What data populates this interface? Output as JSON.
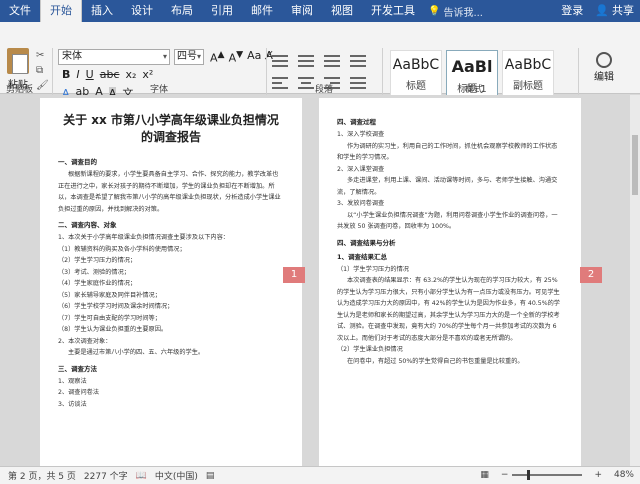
{
  "tabs": [
    "文件",
    "开始",
    "插入",
    "设计",
    "布局",
    "引用",
    "邮件",
    "审阅",
    "视图",
    "开发工具"
  ],
  "search_placeholder": "告诉我...",
  "login": "登录",
  "share": "共享",
  "ribbon": {
    "paste": "粘贴",
    "font_name": "宋体",
    "font_size": "四号",
    "format_buttons": [
      "B",
      "I",
      "U",
      "abc",
      "x₂",
      "x²"
    ],
    "styles": [
      {
        "sample": "AaBbC",
        "name": "标题"
      },
      {
        "sample": "AaBl",
        "name": "标题 1"
      },
      {
        "sample": "AaBbC",
        "name": "副标题"
      }
    ],
    "edit": "编辑",
    "groups": [
      "剪贴板",
      "字体",
      "段落",
      "样式"
    ]
  },
  "page1": {
    "title": "关于 xx 市第八小学高年级课业负担情况的调查报告",
    "s1": "一、调查目的",
    "s1_text": "根据新课程的要求，小学生要具备自主学习、合作、探究的能力，教学改革也正在进行之中，家长对孩子的期待不断增加，学生的课业负担却在不断增加。所以，本调查是希望了解我市第八小学的高年级课业负担现状，分析造成小学生课业负担过重的原因，并找到解决的对策。",
    "s2": "二、调查内容、对象",
    "s2_text": "1、本次关于小学高年级课业负担情况调查主要涉及以下内容：",
    "items": [
      "（1）教辅资料的购买及各小学科的使用情况；",
      "（2）学生学习压力的情况；",
      "（3）考试、测验的情况；",
      "（4）学生家庭作业的情况；",
      "（5）家长辅导家庭及同伴目补情况；",
      "（6）学生学校学习时间及课余时间情况；",
      "（7）学生可自由支配的学习时间等；",
      "（8）学生认为课业负担重的主要原因。"
    ],
    "s2b": "2、本次调查对象：",
    "s2b_text": "主要是通过市第八小学的四、五、六年级的学生。",
    "s3": "三、调查方法",
    "methods": [
      "1、观察法",
      "2、调查问卷法",
      "3、访谈法"
    ],
    "page_number": "1"
  },
  "page2": {
    "s4": "四、调查过程",
    "p1_title": "1、深入学校调查",
    "p1_text": "作为调研的实习生，利用自己的工作时间，抓住机会观察学校教师的工作状态和学生的学习情况。",
    "p2_title": "2、深入课堂调查",
    "p2_text": "多走进课堂，利用上课、课间、活动课等时间，多与、老师学生接触、沟通交流，了解情况。",
    "p3_title": "3、发放问卷调查",
    "p3_text": "以“小学生课业负担情况调查”为题，利用问卷调查小学生作业的调查问卷，一共发放 50 张调查问卷，回收率为 100%。",
    "s5": "四、调查结果与分析",
    "r1": "1、调查结果汇总",
    "r1a": "（1）学生学习压力的情况",
    "r1a_text": "本次调查表的结果显示：有 63.2%的学生认为现在的学习压力较大，有 25%的学生认为学习压力很大，只有小部分学生认为有一点压力或没有压力。可见学生认为造成学习压力大的原因中，有 42%的学生认为是因为作业多，有 40.5%的学生认为是老师和家长的期望过高，其余学生认为学习压力大的是一个全新的学校考试、测验。在调查中发现，竟有大约 70%的学生每个月一共参加考试的次数为 6 次以上。而他们对于考试的态度大部分是不喜欢的或者无所谓的。",
    "r1b": "（2）学生课业负担情况",
    "r1b_text": "在问卷中，有超过 50%的学生觉得自己的书包重量是比较重的。",
    "page_number": "2"
  },
  "status": {
    "page": "第 2 页，共 5 页",
    "words": "2277 个字",
    "lang": "中文(中国)",
    "zoom": "48%",
    "zoom_fraction": 0.48
  }
}
